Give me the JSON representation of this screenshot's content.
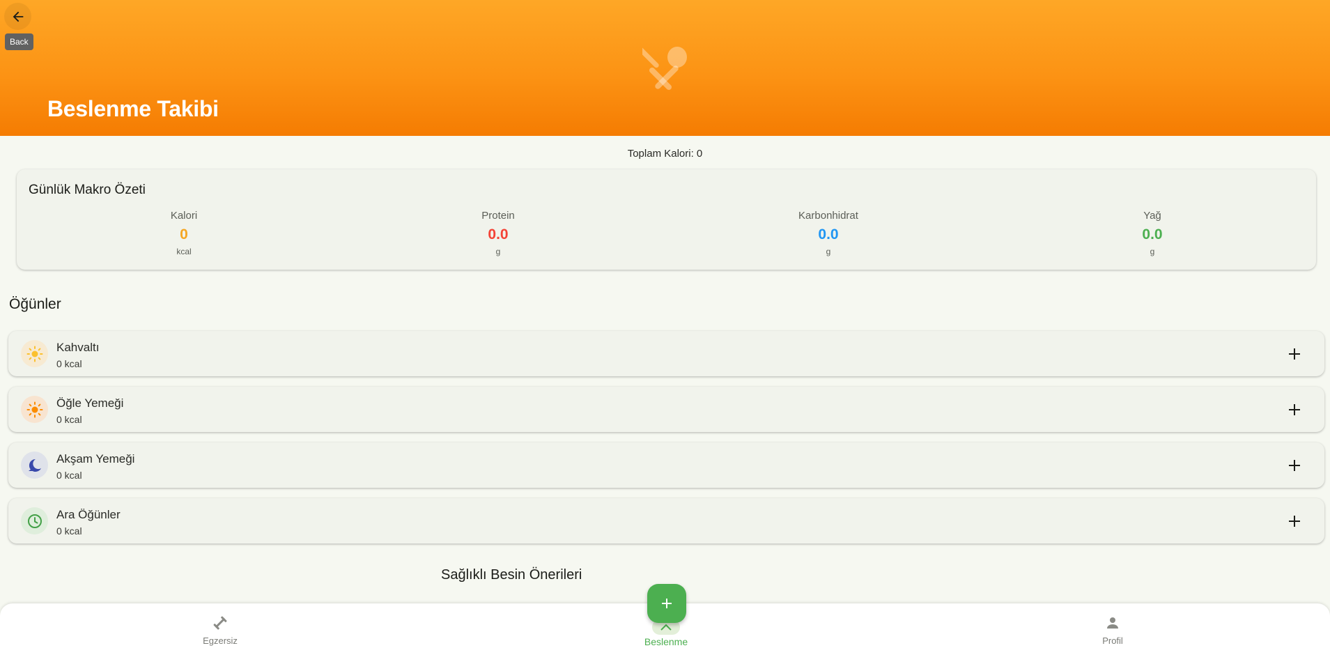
{
  "header": {
    "back_tooltip": "Back",
    "title": "Beslenme Takibi",
    "illustration_icon": "fork-spoon-icon"
  },
  "summary": {
    "total_calories": "Toplam Kalori: 0"
  },
  "macro_card": {
    "title": "Günlük Makro Özeti",
    "items": [
      {
        "label": "Kalori",
        "value": "0",
        "unit": "kcal",
        "color": "#f5a623"
      },
      {
        "label": "Protein",
        "value": "0.0",
        "unit": "g",
        "color": "#f44336"
      },
      {
        "label": "Karbonhidrat",
        "value": "0.0",
        "unit": "g",
        "color": "#2196f3"
      },
      {
        "label": "Yağ",
        "value": "0.0",
        "unit": "g",
        "color": "#4caf50"
      }
    ]
  },
  "meals_section": {
    "title": "Öğünler",
    "meals": [
      {
        "name": "Kahvaltı",
        "kcal": "0 kcal",
        "icon": "sun-icon",
        "icon_color": "#fbc02d",
        "icon_bg": "#f7ead2"
      },
      {
        "name": "Öğle Yemeği",
        "kcal": "0 kcal",
        "icon": "sun-icon",
        "icon_color": "#fb8c00",
        "icon_bg": "#f8e4d0"
      },
      {
        "name": "Akşam Yemeği",
        "kcal": "0 kcal",
        "icon": "moon-icon",
        "icon_color": "#3949ab",
        "icon_bg": "#dfe2ea"
      },
      {
        "name": "Ara Öğünler",
        "kcal": "0 kcal",
        "icon": "clock-icon",
        "icon_color": "#43a047",
        "icon_bg": "#dfeedc"
      }
    ]
  },
  "suggestions": {
    "title": "Sağlıklı Besin Önerileri"
  },
  "bottom_nav": {
    "items": [
      {
        "label": "Egzersiz",
        "icon": "fitness-icon",
        "active": false
      },
      {
        "label": "Beslenme",
        "icon": "restaurant-icon",
        "active": true
      },
      {
        "label": "Profil",
        "icon": "person-icon",
        "active": false
      }
    ],
    "active_color": "#4caf50"
  },
  "fab": {
    "icon": "plus-icon",
    "color": "#4caf50"
  }
}
